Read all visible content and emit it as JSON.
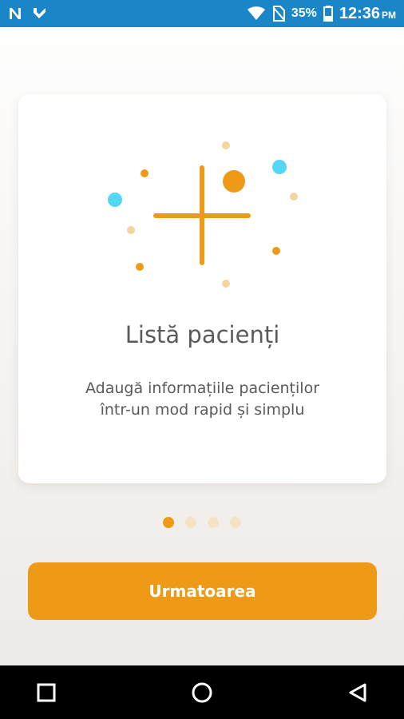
{
  "status_bar": {
    "icons": [
      "notification-n-icon",
      "notification-check-icon",
      "wifi-icon",
      "no-sim-icon",
      "battery-icon"
    ],
    "battery": "35%",
    "time": "12:36",
    "ampm": "PM",
    "background": "#1a86c8"
  },
  "onboarding": {
    "title": "Listă pacienți",
    "description": "Adaugă informațiile pacienților într-un mod rapid și simplu",
    "illustration_icon": "plus-icon",
    "page_indicator": {
      "total": 4,
      "current": 1
    }
  },
  "actions": {
    "next_label": "Urmatoarea"
  },
  "nav_bar": {
    "icons": [
      "recents-square-icon",
      "home-circle-icon",
      "back-triangle-icon"
    ]
  },
  "colors": {
    "accent": "#ef9a16",
    "accent_light": "#f5d49e",
    "cyan": "#55d6f5",
    "text": "#5a5a5a"
  }
}
